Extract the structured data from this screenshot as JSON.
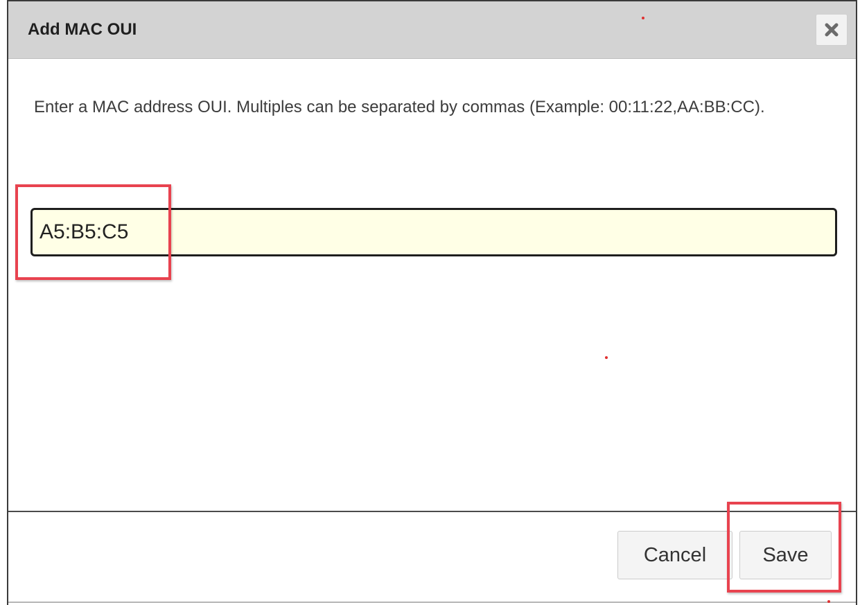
{
  "dialog": {
    "title": "Add MAC OUI",
    "close_icon": "close-icon",
    "instructions": "Enter a MAC address OUI. Multiples can be separated by commas (Example: 00:11:22,AA:BB:CC).",
    "oui_input": {
      "value": "A5:B5:C5",
      "background_color": "#ffffe6"
    },
    "buttons": {
      "cancel_label": "Cancel",
      "save_label": "Save"
    }
  },
  "annotation_color": "#e8434f"
}
